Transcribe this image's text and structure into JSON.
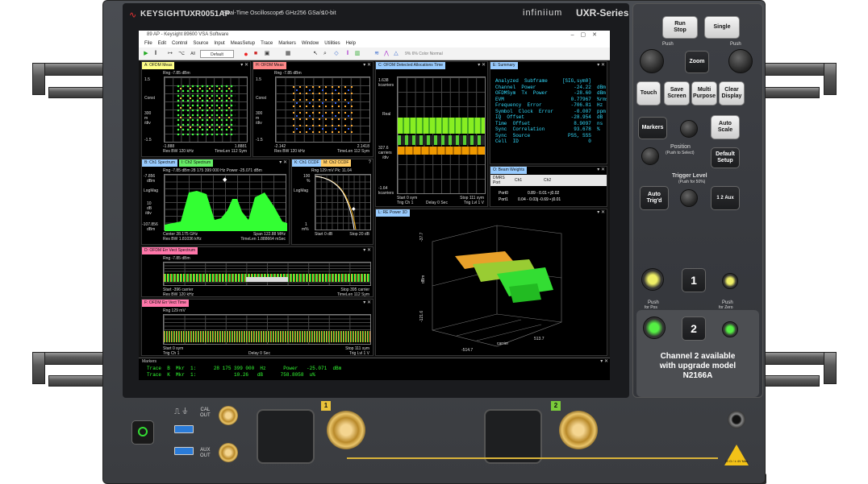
{
  "bezel": {
    "brand": "KEYSIGHT",
    "model": "UXR0051AP",
    "desc": "Real-Time Oscilloscope",
    "bw": "5 GHz",
    "rate": "256 GSa/s",
    "bits": "10-bit",
    "series_logo": "infiniium",
    "series": "UXR-Series"
  },
  "window": {
    "title": "89 AP - Keysight 89600 VSA Software"
  },
  "menu": [
    "File",
    "Edit",
    "Control",
    "Source",
    "Input",
    "MeasSetup",
    "Trace",
    "Markers",
    "Window",
    "Utilities",
    "Help"
  ],
  "toolbar": {
    "trigger": "All",
    "preset": "Default",
    "status": "9%  6%  Color Normal"
  },
  "panels": {
    "a": {
      "tab": "A: OFDM Meas",
      "top": "Rng -7.85 dBm",
      "y1": "1.5",
      "y2": "Const",
      "y3": "300",
      "y4": "m",
      "y5": "/div",
      "y6": "-1.5",
      "bl": "-1.888",
      "br": "1.8881",
      "bl2": "Res BW 120 kHz",
      "br2": "TimeLen 112  Sym"
    },
    "h": {
      "tab": "H: OFDM Meas",
      "top": "Rng -7.85 dBm",
      "y1": "1.5",
      "y2": "Const",
      "y3": "300",
      "y4": "m",
      "y5": "/div",
      "y6": "-1.5",
      "bl": "-2.142",
      "br": "2.1418",
      "bl2": "Res BW 120 kHz",
      "br2": "TimeLen 112  Sym"
    },
    "c": {
      "tab": "C: OFDM Detected Allocations Time",
      "y1": "1.638",
      "y1b": "kcarriers",
      "y2": "Real",
      "y3": "327.6",
      "y3b": "carriers",
      "y3c": "/div",
      "y4": "-1.64",
      "y4b": "kcarriers",
      "bl": "Start 0  sym",
      "bc": "Delay 0  Sec",
      "br": "Stop 111  sym",
      "bl2": "Trig Ch 1",
      "br2": "Trig Lvl 1  V"
    },
    "e": {
      "tab": "E: Summary"
    },
    "b": {
      "tab": "B: Ch1 Spectrum",
      "tab2": "I: Ch2 Spectrum",
      "top": "Rng -7.85 dBm  28 175 399 000  Hz     Power   -25.071  dBm",
      "y1": "-7.856",
      "y1b": "dBm",
      "y2": "LogMag",
      "y3": "10",
      "y3b": "dB",
      "y3c": "/div",
      "y4": "-107.856",
      "y4b": "dBm",
      "bl": "Center 28.175 GHz",
      "br": "Span 122.88 MHz",
      "bl2": "Res BW 1.81036 kHz",
      "br2": "TimeLen 1.888664 mSec"
    },
    "k": {
      "tab": "K: Ch1 CCDF",
      "tab2": "M: Ch2 CCDF",
      "top": "Rng 129 mV    Pk: 11.04",
      "y1": "100",
      "y1b": "%",
      "y2": "LogMag",
      "y3": "1",
      "y3b": "m%",
      "bl": "Start 0 dB",
      "br": "Stop 20 dB"
    },
    "o": {
      "tab": "O: Beam Weights",
      "hdr1": "DMRS",
      "hdr1b": "Port",
      "hdr2": "Ch1",
      "hdr3": "Ch2",
      "r1a": "Port0",
      "r1b": "0.89 - 0.01 • j0.02",
      "r2a": "Port1",
      "r2b": "0.04 - 0.03j  -0.69 • j0.01"
    },
    "d": {
      "tab": "D: OFDM Err Vect Spectrum",
      "top": "Rng -7.85 dBm",
      "bl": "Start -396  carrier",
      "br": "Stop 395  carrier",
      "bl2": "Res BW 120 kHz",
      "br2": "TimeLen 112  Sym"
    },
    "f": {
      "tab": "F: OFDM Err Vect Time",
      "top": "Rng 129 mV",
      "bl": "Start 0  sym",
      "bc": "Delay 0  Sec",
      "br": "Stop 111  sym",
      "bl2": "Trig Ch 1",
      "br2": "Trig Lvl 1  V"
    },
    "l": {
      "tab": "L: RE Power 3D",
      "z1": "-37.7",
      "z2": "dBm",
      "z3": "-121.6",
      "x1": "-514.7",
      "x2": "carrier",
      "x3": "513.7"
    }
  },
  "summary": [
    [
      "Analyzed  Subframe",
      "[SIG,sym0]",
      ""
    ],
    [
      "Channel  Power",
      "-24.22",
      "dBm"
    ],
    [
      "OFDMSym  Tx  Power",
      "-28.60",
      "dBm"
    ],
    [
      "EVM",
      "0.77967",
      "%rms"
    ],
    [
      "Frequency  Error",
      "-706.81",
      "Hz"
    ],
    [
      "Symbol  Clock  Error",
      "-0.007",
      "ppm"
    ],
    [
      "IQ  Offset",
      "-28.954",
      "dB"
    ],
    [
      "Time  Offset",
      "8.9097",
      "ns"
    ],
    [
      "Sync  Correlation",
      "93.678",
      "%"
    ],
    [
      "Sync  Source",
      "PSS, SSS",
      ""
    ],
    [
      "Cell  ID",
      "0",
      ""
    ]
  ],
  "markers": {
    "title": "Markers",
    "l1": "Trace  B  Mkr  1:      28 175 399 000  Hz      Power   -25.071  dBm",
    "l2": "Trace  K  Mkr  1:             10.26   dB      758.8058  u%"
  },
  "front": {
    "run": "Run",
    "stop": "Stop",
    "single": "Single",
    "push_fine": "Push",
    "push_fine2": "for Fine",
    "push_fine_r": "Push",
    "push_fine_r2": "for Fine",
    "zoom": "Zoom",
    "touch": "Touch",
    "save": "Save",
    "save2": "Screen",
    "multi": "Multi",
    "multi2": "Purpose",
    "clear": "Clear",
    "clear2": "Display",
    "markers": "Markers",
    "auto": "Auto",
    "auto2": "Scale",
    "position": "Position",
    "position2": "(Push to Select)",
    "default": "Default",
    "default2": "Setup",
    "trig_level": "Trigger Level",
    "trig_level2": "(Push for 50%)",
    "auto_trig": "Auto",
    "auto_trig2": "Trig'd",
    "aux1": "1",
    "aux2": "2",
    "aux3": "Aux",
    "ch1": "1",
    "ch2": "2",
    "push_pos": "Push",
    "push_pos2": "for Pos",
    "push_zero": "Push",
    "push_zero2": "for Zero",
    "upgrade1": "Channel 2 available",
    "upgrade2": "with upgrade model",
    "upgrade3": "N2166A",
    "cal": "CAL",
    "cal2": "OUT",
    "aux_out": "AUX",
    "aux_out2": "OUT",
    "in1": "1",
    "in2": "2",
    "warn": "50 Ω / ± 4V Max"
  }
}
